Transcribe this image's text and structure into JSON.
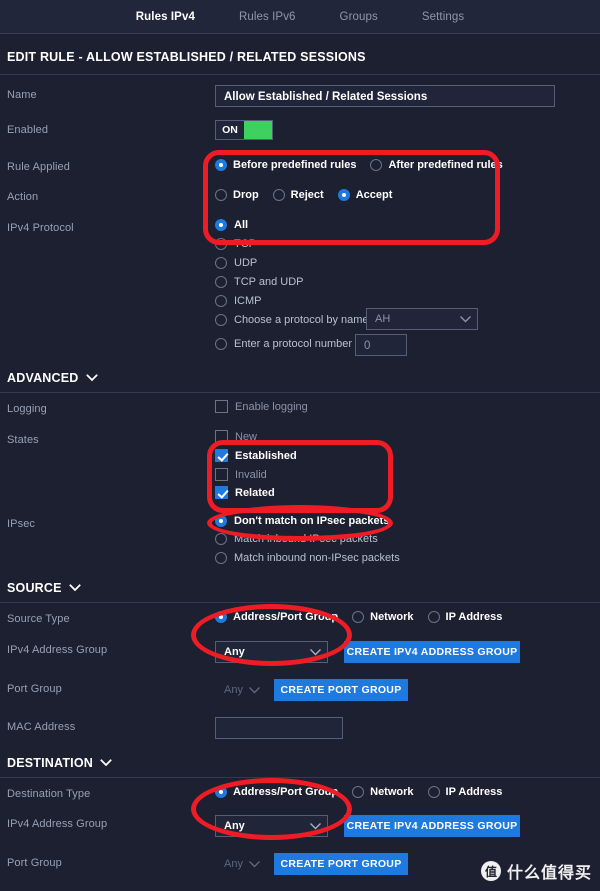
{
  "colors": {
    "background": "#1d2030",
    "header_bar": "#22263a",
    "accent_blue": "#1f7ae0",
    "toggle_green": "#3fd160",
    "annotation_red": "#ee1c25",
    "label_grey": "#98a0b5",
    "divider": "#343950"
  },
  "tabs": [
    {
      "label": "Rules IPv4",
      "active": true
    },
    {
      "label": "Rules IPv6",
      "active": false
    },
    {
      "label": "Groups",
      "active": false
    },
    {
      "label": "Settings",
      "active": false
    }
  ],
  "page_title": "EDIT RULE - ALLOW ESTABLISHED / RELATED SESSIONS",
  "fields": {
    "name_label": "Name",
    "name_value": "Allow Established / Related Sessions",
    "enabled_label": "Enabled",
    "enabled_toggle": "ON",
    "rule_applied_label": "Rule Applied",
    "action_label": "Action",
    "protocol_label": "IPv4 Protocol"
  },
  "rule_applied_options": [
    {
      "label": "Before predefined rules",
      "selected": true
    },
    {
      "label": "After predefined rules",
      "selected": false
    }
  ],
  "action_options": [
    {
      "label": "Drop",
      "selected": false
    },
    {
      "label": "Reject",
      "selected": false
    },
    {
      "label": "Accept",
      "selected": true
    }
  ],
  "protocol_options": [
    {
      "label": "All",
      "selected": true
    },
    {
      "label": "TCP",
      "selected": false
    },
    {
      "label": "UDP",
      "selected": false
    },
    {
      "label": "TCP and UDP",
      "selected": false
    },
    {
      "label": "ICMP",
      "selected": false
    },
    {
      "label": "Choose a protocol by name",
      "selected": false
    },
    {
      "label": "Enter a protocol number",
      "selected": false
    }
  ],
  "protocol_name_select": {
    "value": "AH",
    "disabled": true
  },
  "protocol_number_input": {
    "value": "0",
    "disabled": true
  },
  "advanced": {
    "section_title": "ADVANCED",
    "logging_label": "Logging",
    "logging_checkbox": {
      "label": "Enable logging",
      "checked": false
    },
    "states_label": "States",
    "states": [
      {
        "label": "New",
        "checked": false
      },
      {
        "label": "Established",
        "checked": true
      },
      {
        "label": "Invalid",
        "checked": false
      },
      {
        "label": "Related",
        "checked": true
      }
    ],
    "ipsec_label": "IPsec",
    "ipsec_options": [
      {
        "label": "Don't match on IPsec packets",
        "selected": true
      },
      {
        "label": "Match inbound IPsec packets",
        "selected": false
      },
      {
        "label": "Match inbound non-IPsec packets",
        "selected": false
      }
    ]
  },
  "source": {
    "section_title": "SOURCE",
    "type_label": "Source Type",
    "type_options": [
      {
        "label": "Address/Port Group",
        "selected": true
      },
      {
        "label": "Network",
        "selected": false
      },
      {
        "label": "IP Address",
        "selected": false
      }
    ],
    "address_group_label": "IPv4 Address Group",
    "address_group_select": {
      "value": "Any",
      "disabled": false
    },
    "create_address_group_button": "CREATE IPV4 ADDRESS GROUP",
    "port_group_label": "Port Group",
    "port_group_select": {
      "value": "Any",
      "disabled": true
    },
    "create_port_group_button": "CREATE PORT GROUP",
    "mac_address_label": "MAC Address",
    "mac_address_value": ""
  },
  "destination": {
    "section_title": "DESTINATION",
    "type_label": "Destination Type",
    "type_options": [
      {
        "label": "Address/Port Group",
        "selected": true
      },
      {
        "label": "Network",
        "selected": false
      },
      {
        "label": "IP Address",
        "selected": false
      }
    ],
    "address_group_label": "IPv4 Address Group",
    "address_group_select": {
      "value": "Any",
      "disabled": false
    },
    "create_address_group_button": "CREATE IPV4 ADDRESS GROUP",
    "port_group_label": "Port Group",
    "port_group_select": {
      "value": "Any",
      "disabled": true
    },
    "create_port_group_button": "CREATE PORT GROUP"
  },
  "watermark": {
    "logo": "值",
    "text": "什么值得买"
  },
  "icons": {
    "chevron_down": "⌄"
  }
}
